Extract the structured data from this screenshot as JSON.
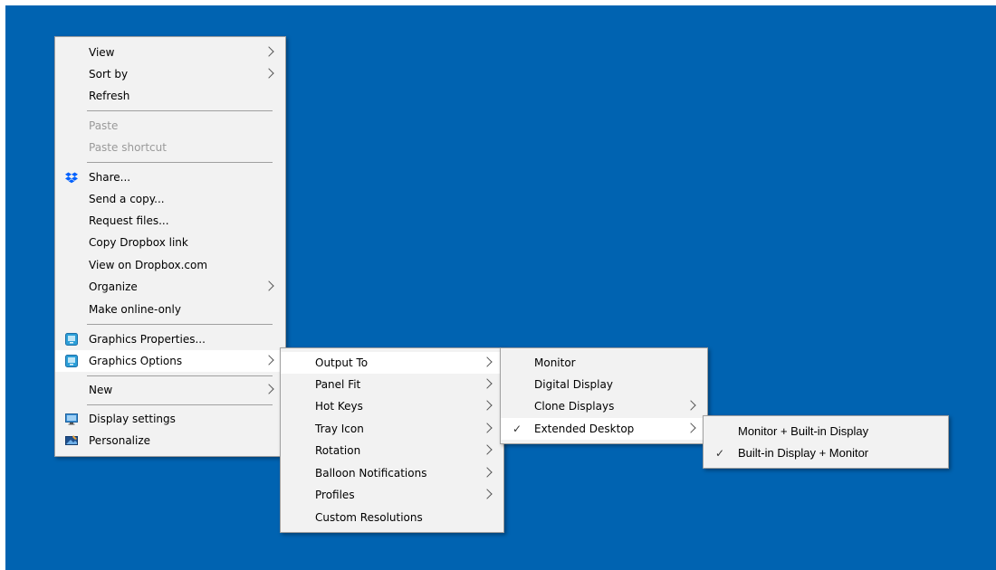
{
  "context_menu": {
    "items": [
      {
        "label": "View"
      },
      {
        "label": "Sort by"
      },
      {
        "label": "Refresh"
      },
      {
        "label": "Paste"
      },
      {
        "label": "Paste shortcut"
      },
      {
        "label": "Share..."
      },
      {
        "label": "Send a copy..."
      },
      {
        "label": "Request files..."
      },
      {
        "label": "Copy Dropbox link"
      },
      {
        "label": "View on Dropbox.com"
      },
      {
        "label": "Organize"
      },
      {
        "label": "Make online-only"
      },
      {
        "label": "Graphics Properties..."
      },
      {
        "label": "Graphics Options"
      },
      {
        "label": "New"
      },
      {
        "label": "Display settings"
      },
      {
        "label": "Personalize"
      }
    ]
  },
  "graphics_options_menu": {
    "items": [
      {
        "label": "Output To"
      },
      {
        "label": "Panel Fit"
      },
      {
        "label": "Hot Keys"
      },
      {
        "label": "Tray Icon"
      },
      {
        "label": "Rotation"
      },
      {
        "label": "Balloon Notifications"
      },
      {
        "label": "Profiles"
      },
      {
        "label": "Custom Resolutions"
      }
    ]
  },
  "output_to_menu": {
    "items": [
      {
        "label": "Monitor"
      },
      {
        "label": "Digital Display"
      },
      {
        "label": "Clone Displays"
      },
      {
        "label": "Extended Desktop",
        "checked": true
      }
    ]
  },
  "extended_desktop_menu": {
    "items": [
      {
        "label": "Monitor + Built-in Display"
      },
      {
        "label": "Built-in Display + Monitor",
        "checked": true
      }
    ]
  },
  "glyphs": {
    "check": "✓"
  },
  "icons": {
    "dropbox": "dropbox-icon",
    "graphics_properties": "intel-graphics-icon",
    "graphics_options": "intel-graphics-icon",
    "display_settings": "display-icon",
    "personalize": "personalize-icon"
  },
  "colors": {
    "desktop": "#0063b1",
    "menu_background": "#f2f2f2",
    "highlight": "#ffffff",
    "disabled_text": "#9a9a9a"
  }
}
